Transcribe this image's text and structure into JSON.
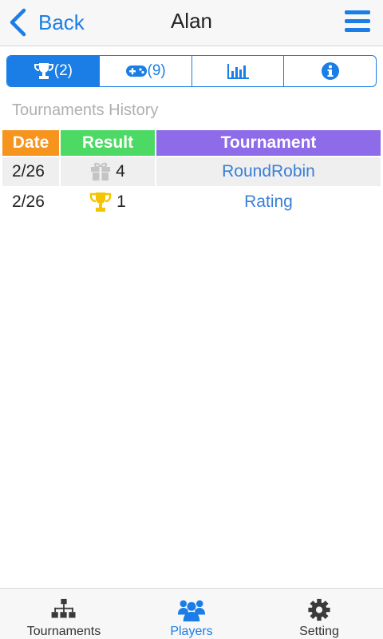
{
  "header": {
    "back_label": "Back",
    "title": "Alan"
  },
  "tabs": [
    {
      "icon": "trophy-icon",
      "label": "(2)",
      "active": true
    },
    {
      "icon": "gamepad-icon",
      "label": "(9)",
      "active": false
    },
    {
      "icon": "bar-chart-icon",
      "label": "",
      "active": false
    },
    {
      "icon": "info-icon",
      "label": "",
      "active": false
    }
  ],
  "section_title": "Tournaments History",
  "table": {
    "columns": [
      "Date",
      "Result",
      "Tournament"
    ],
    "column_colors": {
      "date": "#f7941d",
      "result": "#4cd964",
      "tournament": "#8e6be8"
    },
    "rows": [
      {
        "date": "2/26",
        "result_icon": "gift-icon",
        "result": "4",
        "tournament": "RoundRobin"
      },
      {
        "date": "2/26",
        "result_icon": "trophy-icon",
        "result": "1",
        "tournament": "Rating"
      }
    ]
  },
  "bottom_nav": [
    {
      "icon": "bracket-icon",
      "label": "Tournaments",
      "active": false
    },
    {
      "icon": "players-icon",
      "label": "Players",
      "active": true
    },
    {
      "icon": "gear-icon",
      "label": "Setting",
      "active": false
    }
  ],
  "colors": {
    "accent": "#1a7ee6",
    "link": "#3a7fd5",
    "trophy_gold": "#f5c400",
    "gift_gray": "#c4c4c4"
  }
}
